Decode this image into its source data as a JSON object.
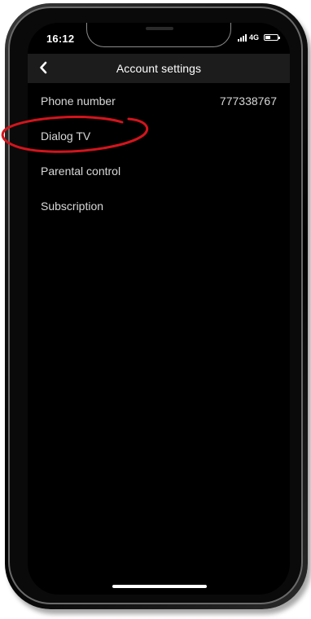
{
  "status_bar": {
    "time": "16:12",
    "network": "4G"
  },
  "header": {
    "title": "Account settings",
    "back_icon": "chevron-left-icon"
  },
  "settings": {
    "items": [
      {
        "label": "Phone number",
        "value": "777338767"
      },
      {
        "label": "Dialog TV",
        "value": ""
      },
      {
        "label": "Parental control",
        "value": ""
      },
      {
        "label": "Subscription",
        "value": ""
      }
    ]
  },
  "colors": {
    "screen_background": "#000000",
    "header_background": "#1c1c1c",
    "text": "#d8d8d8",
    "annotation": "#d4141c"
  }
}
